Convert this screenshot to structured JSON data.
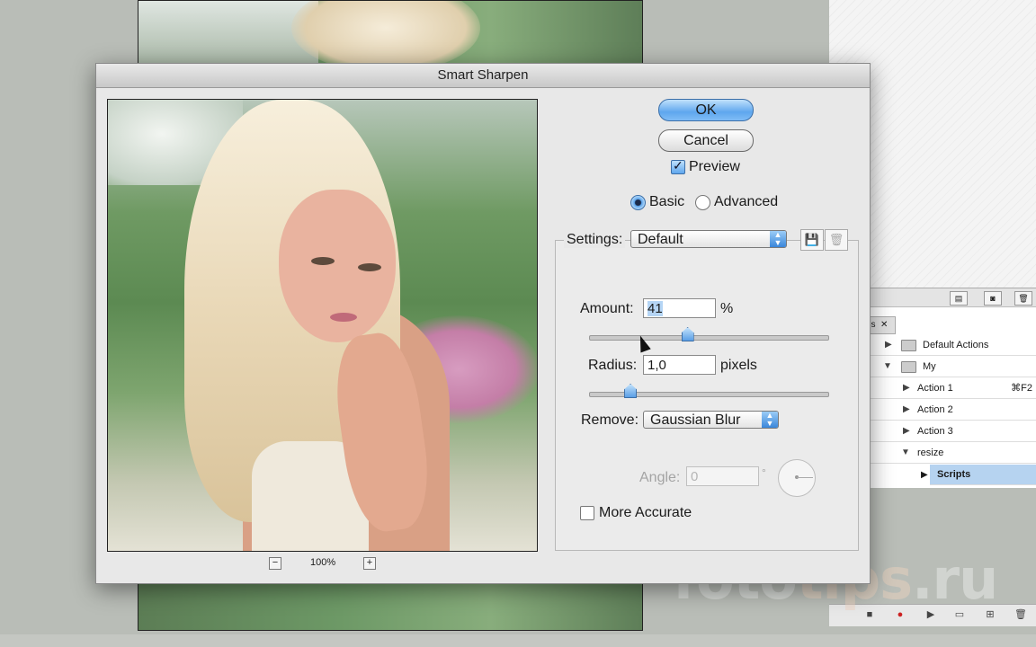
{
  "dialog": {
    "title": "Smart Sharpen",
    "ok_label": "OK",
    "cancel_label": "Cancel",
    "preview_label": "Preview",
    "preview_checked": true,
    "mode_basic_label": "Basic",
    "mode_advanced_label": "Advanced",
    "selected_mode": "Basic",
    "zoom_level": "100%",
    "zoom_out_label": "−",
    "zoom_in_label": "+",
    "settings_label": "Settings:",
    "settings_value": "Default",
    "amount_label": "Amount:",
    "amount_value": "41",
    "amount_unit": "%",
    "amount_fraction": 0.41,
    "radius_label": "Radius:",
    "radius_value": "1,0",
    "radius_unit": "pixels",
    "radius_fraction": 0.17,
    "remove_label": "Remove:",
    "remove_value": "Gaussian Blur",
    "angle_label": "Angle:",
    "angle_value": "0",
    "angle_unit": "°",
    "more_accurate_label": "More Accurate",
    "more_accurate_checked": false
  },
  "actions_panel": {
    "tab_label": "ns",
    "tab_close": "✕",
    "items": [
      {
        "label": "Default Actions",
        "type": "set",
        "expanded": false
      },
      {
        "label": "My",
        "type": "set",
        "expanded": true
      },
      {
        "label": "Action 1",
        "type": "action",
        "shortcut": "⌘F2"
      },
      {
        "label": "Action 2",
        "type": "action"
      },
      {
        "label": "Action 3",
        "type": "action"
      },
      {
        "label": "resize",
        "type": "action",
        "expanded": true
      },
      {
        "label": "Scripts",
        "type": "step",
        "selected": true
      }
    ]
  },
  "watermark": {
    "part1": "foto",
    "part2": "tips",
    "part3": ".ru"
  },
  "colors": {
    "accent": "#5fa7ee",
    "selection": "#b6d3f0"
  }
}
